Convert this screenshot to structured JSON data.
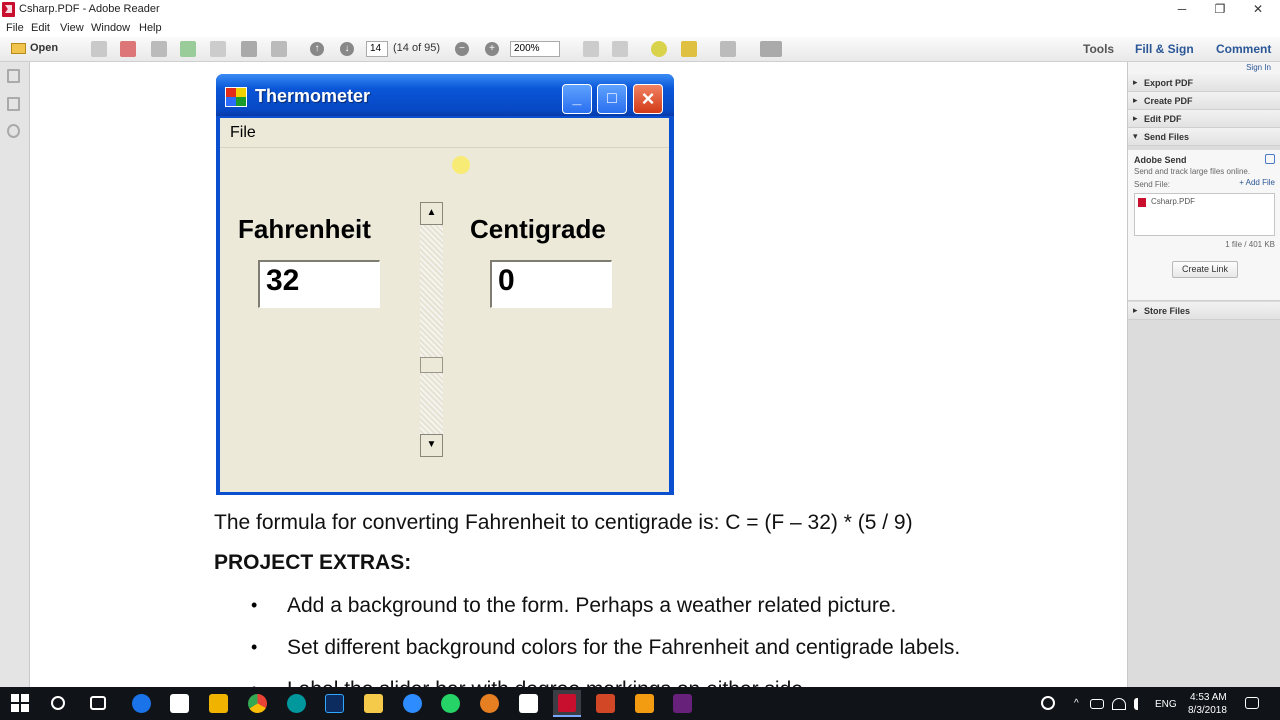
{
  "window": {
    "title": "Csharp.PDF - Adobe Reader",
    "controls": [
      "─",
      "❐",
      "✕"
    ]
  },
  "menubar": [
    "File",
    "Edit",
    "View",
    "Window",
    "Help"
  ],
  "toolbar": {
    "open_label": "Open",
    "page_number": "14",
    "page_count": "(14 of 95)",
    "zoom": "200%",
    "tools_label": "Tools",
    "fill_sign_label": "Fill & Sign",
    "comment_label": "Comment"
  },
  "right_panel": {
    "sign_in": "Sign In",
    "sections": [
      "Export PDF",
      "Create PDF",
      "Edit PDF",
      "Send Files"
    ],
    "adobe_send_title": "Adobe Send",
    "adobe_send_desc": "Send and track large files online.",
    "send_file_label": "Send File:",
    "add_file_label": "+ Add File",
    "file_name": "Csharp.PDF",
    "file_count": "1 file / 401 KB",
    "create_link_label": "Create Link",
    "store_files_label": "Store Files"
  },
  "embedded_app": {
    "title": "Thermometer",
    "menu_file": "File",
    "fahrenheit_label": "Fahrenheit",
    "fahrenheit_value": "32",
    "centigrade_label": "Centigrade",
    "centigrade_value": "0",
    "scroll_up": "▲",
    "scroll_down": "▼"
  },
  "document": {
    "formula_line": "The formula for converting Fahrenheit to centigrade is: C = (F – 32) * (5 / 9)",
    "extras_heading": "PROJECT EXTRAS:",
    "bullets": [
      "Add a background to the form. Perhaps a weather related picture.",
      "Set different background colors for the Fahrenheit and centigrade labels.",
      "Label the slider bar with degree markings on either side."
    ],
    "bullet_glyph": "•"
  },
  "taskbar": {
    "language": "ENG",
    "time": "4:53 AM",
    "date": "8/3/2018"
  },
  "colors": {
    "xp_title_blue": "#0a56d8",
    "xp_body": "#ece9d8",
    "close_red": "#d33a17",
    "taskbar": "#101318",
    "accent_blue": "#2b5797"
  }
}
